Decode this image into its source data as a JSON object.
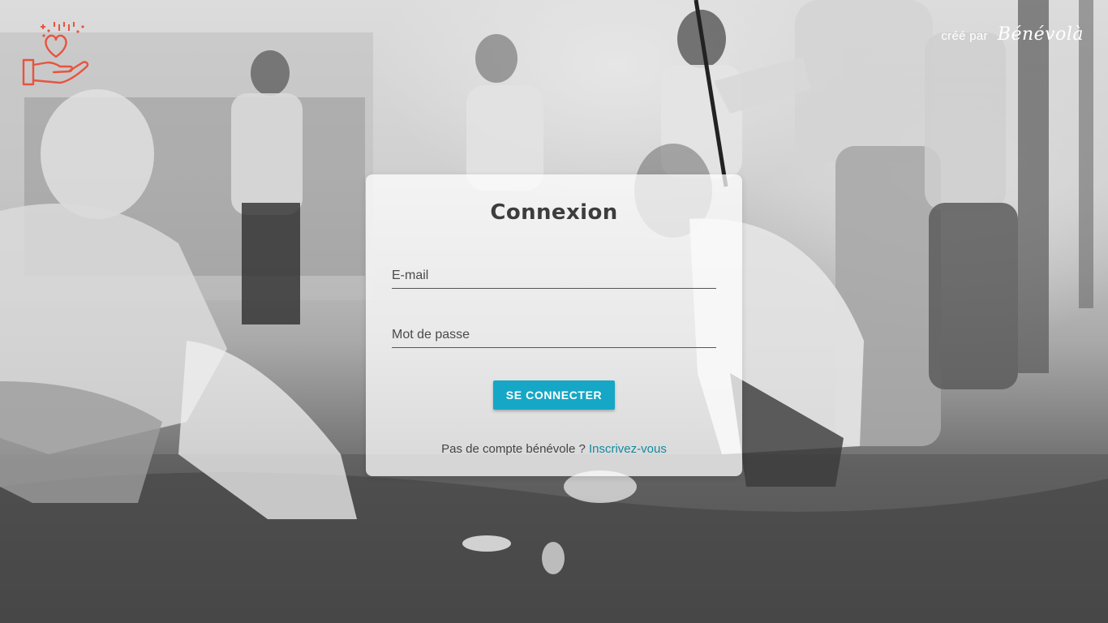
{
  "credit": {
    "prefix": "créé par",
    "brand": "Bénévolà"
  },
  "logo": {
    "icon": "heart-hand-icon",
    "color": "#e8533f"
  },
  "login": {
    "title": "Connexion",
    "email_placeholder": "E-mail",
    "password_placeholder": "Mot de passe",
    "submit_label": "SE CONNECTER",
    "signup_prompt": "Pas de compte bénévole ? ",
    "signup_link": "Inscrivez-vous"
  },
  "colors": {
    "accent": "#16a7c6",
    "link": "#15899f",
    "logo": "#e8533f"
  }
}
